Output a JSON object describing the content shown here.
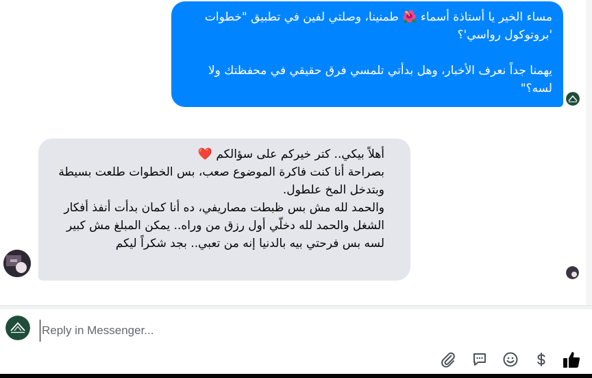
{
  "conversation": {
    "outgoing_message": {
      "lines": [
        "مساء الخير يا أستاذة أسماء 🌺 طمنينا، وصلتي لفين في تطبيق \"خطوات 'بروتوكول رواسي'؟",
        "يهمنا جداً نعرف الأخبار، وهل بدأتي تلمسي فرق حقيقي في محفظتك ولا لسه؟\""
      ]
    },
    "incoming_message": {
      "lines": [
        "أهلاً بيكي.. كتر خيركم على سؤالكم ❤️",
        "بصراحة أنا كنت فاكرة الموضوع صعب، بس الخطوات طلعت بسيطة وبتدخل المخ علطول.",
        "والحمد لله مش بس ظبطت مصاريفي، ده أنا كمان بدأت أنفذ أفكار الشغل والحمد لله دخلّي أول رزق من وراه.. يمكن المبلغ مش كبير لسه بس فرحتي بيه بالدنيا إنه من تعبي.. بجد شكراً ليكم"
      ]
    }
  },
  "composer": {
    "placeholder": "Reply in Messenger..."
  },
  "actions": {
    "icons": [
      "paperclip-icon",
      "sticker-chat-icon",
      "emoji-icon",
      "dollar-icon",
      "thumbs-up-icon"
    ]
  },
  "colors": {
    "accent": "#0084ff",
    "incoming_bubble": "#e4e6eb",
    "page_logo_bg": "#1f4d3a"
  }
}
